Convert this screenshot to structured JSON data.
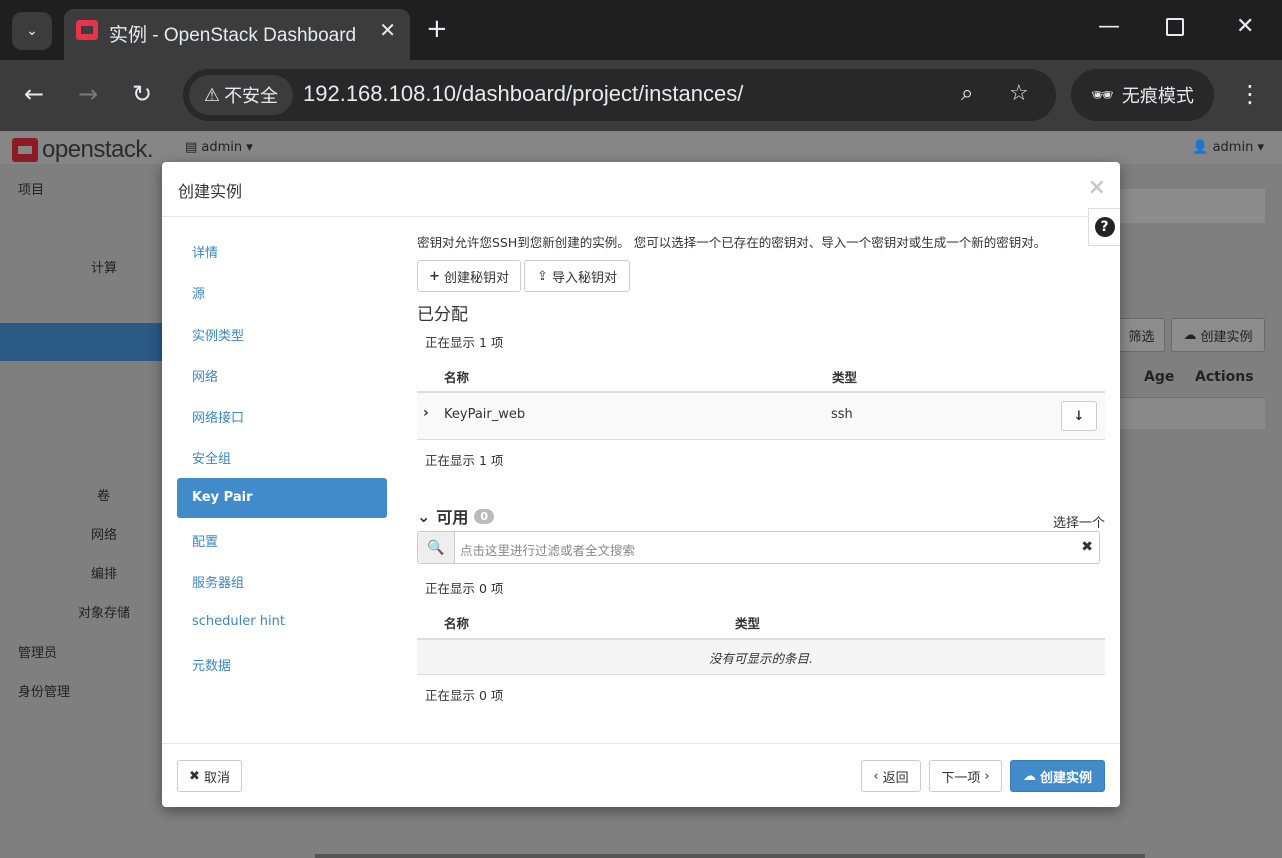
{
  "browser": {
    "tab_title": "实例 - OpenStack Dashboard",
    "url": "192.168.108.10/dashboard/project/instances/",
    "security_label": "不安全",
    "incognito_label": "无痕模式"
  },
  "header": {
    "logo_text": "openstack.",
    "project": "admin",
    "user": "admin"
  },
  "sidebar": {
    "project": "项目",
    "compute": "计算",
    "volumes": "卷",
    "network": "网络",
    "orchestration": "编排",
    "object_store": "对象存储",
    "admin": "管理员",
    "identity": "身份管理"
  },
  "background": {
    "filter_btn": "筛选",
    "create_btn": "创建实例",
    "col_age": "Age",
    "col_actions": "Actions"
  },
  "modal": {
    "title": "创建实例",
    "close": "×",
    "nav": [
      {
        "label": "详情"
      },
      {
        "label": "源"
      },
      {
        "label": "实例类型"
      },
      {
        "label": "网络"
      },
      {
        "label": "网络接口"
      },
      {
        "label": "安全组"
      },
      {
        "label": "Key Pair"
      },
      {
        "label": "配置"
      },
      {
        "label": "服务器组"
      },
      {
        "label": "scheduler hint"
      },
      {
        "label": "元数据"
      }
    ],
    "intro": "密钥对允许您SSH到您新创建的实例。 您可以选择一个已存在的密钥对、导入一个密钥对或生成一个新的密钥对。",
    "create_keypair_btn": "创建秘钥对",
    "import_keypair_btn": "导入秘钥对",
    "allocated": {
      "title": "已分配",
      "count_top": "正在显示 1 项",
      "count_bottom": "正在显示 1 项",
      "col_name": "名称",
      "col_type": "类型",
      "rows": [
        {
          "name": "KeyPair_web",
          "type": "ssh"
        }
      ]
    },
    "available": {
      "title": "可用",
      "badge": "0",
      "select_one": "选择一个",
      "search_placeholder": "点击这里进行过滤或者全文搜索",
      "count_top": "正在显示 0 项",
      "count_bottom": "正在显示 0 项",
      "col_name": "名称",
      "col_type": "类型",
      "empty": "没有可显示的条目."
    },
    "footer": {
      "cancel": "取消",
      "back": "返回",
      "next": "下一项",
      "launch": "创建实例"
    }
  }
}
